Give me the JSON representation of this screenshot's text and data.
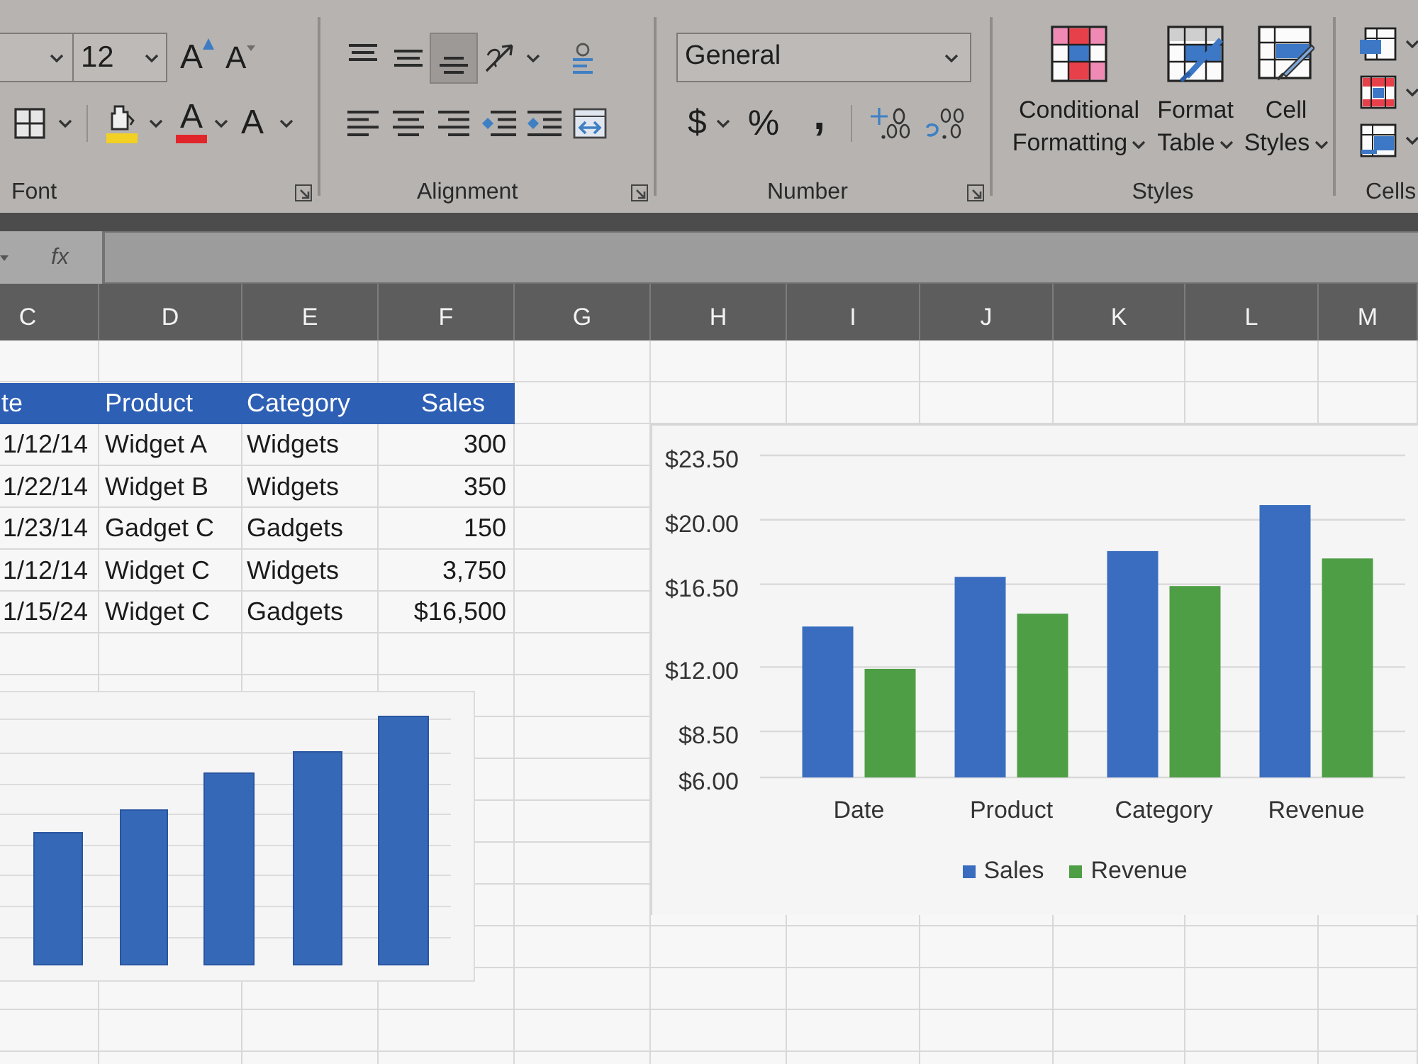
{
  "ribbon": {
    "font": {
      "label": "Font",
      "size": "12",
      "grow_glyph": "A",
      "shrink_glyph": "A",
      "color_glyph": "A",
      "effects_glyph": "A"
    },
    "alignment": {
      "label": "Alignment",
      "top_row": [
        {
          "kind": "top",
          "selected": false
        },
        {
          "kind": "middle",
          "selected": false
        },
        {
          "kind": "bottom",
          "selected": true
        },
        {
          "kind": "orientation",
          "selected": false
        },
        {
          "kind": "wrap",
          "selected": false
        }
      ],
      "bottom_row": [
        {
          "kind": "left",
          "selected": false
        },
        {
          "kind": "center",
          "selected": false
        },
        {
          "kind": "right",
          "selected": false
        },
        {
          "kind": "outdent",
          "selected": false
        },
        {
          "kind": "indent",
          "selected": false
        },
        {
          "kind": "merge",
          "selected": false
        }
      ]
    },
    "number": {
      "label": "Number",
      "format": "General",
      "currency_glyph": "$",
      "percent_glyph": "%",
      "comma_glyph": ","
    },
    "styles": {
      "label": "Styles",
      "buttons": [
        {
          "kind": "conditional",
          "label": "Conditional Formatting"
        },
        {
          "kind": "table",
          "label": "Format Table"
        },
        {
          "kind": "cell",
          "label": "Cell Styles"
        }
      ]
    },
    "cells": {
      "label": "Cells"
    }
  },
  "formula_bar": {
    "function_glyph": "fx"
  },
  "sheet": {
    "columns": [
      "C",
      "D",
      "E",
      "F",
      "G",
      "H",
      "I",
      "J",
      "K",
      "L",
      "M"
    ],
    "table": {
      "header": [
        "te",
        "Product",
        "Category",
        "Sales"
      ],
      "rows": [
        [
          "1/12/14",
          "Widget A",
          "Widgets",
          "300"
        ],
        [
          "1/22/14",
          "Widget B",
          "Widgets",
          "350"
        ],
        [
          "1/23/14",
          "Gadget C",
          "Gadgets",
          "150"
        ],
        [
          "1/12/14",
          "Widget C",
          "Widgets",
          "3,750"
        ],
        [
          "1/15/24",
          "Widget C",
          "Gadgets",
          "$16,500"
        ]
      ]
    },
    "chart": {
      "chart_data": {
        "type": "bar",
        "categories": [
          "Date",
          "Product",
          "Category",
          "Revenue"
        ],
        "series": [
          {
            "name": "Sales",
            "color": "#3a6dbf",
            "values": [
              14.2,
              16.9,
              18.3,
              20.8
            ]
          },
          {
            "name": "Revenue",
            "color": "#4e9e45",
            "values": [
              11.9,
              14.9,
              16.4,
              17.9
            ]
          }
        ],
        "ylim": [
          6,
          23.5
        ],
        "yticks": [
          {
            "value": 6,
            "label": "$6.00"
          },
          {
            "value": 8.5,
            "label": "$8.50"
          },
          {
            "value": 12,
            "label": "$12.00"
          },
          {
            "value": 16.5,
            "label": "$16.50"
          },
          {
            "value": 20,
            "label": "$20.00"
          },
          {
            "value": 23.5,
            "label": "$23.50"
          }
        ],
        "grid": true,
        "legend": "bottom"
      }
    }
  }
}
